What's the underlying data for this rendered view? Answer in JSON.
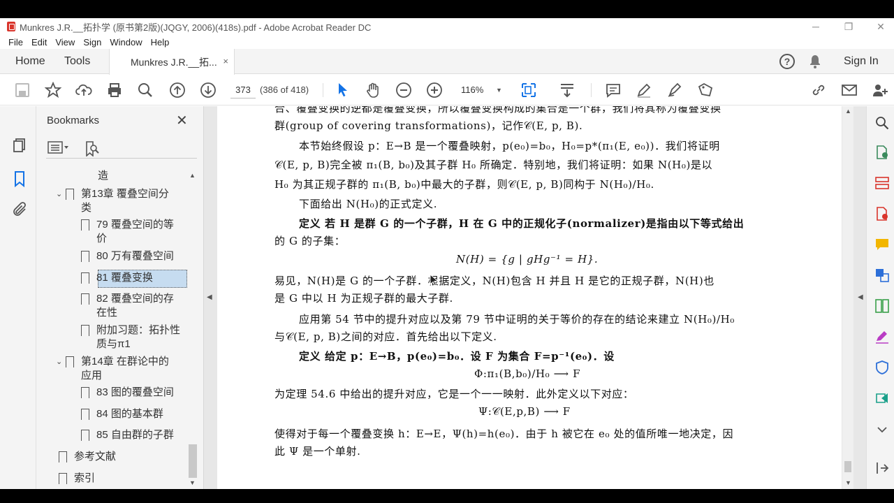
{
  "window": {
    "title": "Munkres J.R.__拓扑学 (原书第2版)(JQGY, 2006)(418s).pdf - Adobe Acrobat Reader DC",
    "minimize": "─",
    "restore": "❐",
    "close": "✕"
  },
  "menu": [
    "File",
    "Edit",
    "View",
    "Sign",
    "Window",
    "Help"
  ],
  "tabs": {
    "home": "Home",
    "tools": "Tools",
    "document": "Munkres J.R.__拓...",
    "close": "×",
    "signin": "Sign In",
    "help": "?"
  },
  "toolbar": {
    "page_number": "373",
    "page_count": "(386 of 418)",
    "zoom": "116%"
  },
  "bookmarks": {
    "title": "Bookmarks",
    "close": "✕",
    "items": [
      {
        "label": "造",
        "level": 2
      },
      {
        "label": "第13章  覆叠空间分类",
        "level": 1,
        "expanded": true
      },
      {
        "label": "79  覆叠空间的等价",
        "level": 2
      },
      {
        "label": "80  万有覆叠空间",
        "level": 2
      },
      {
        "label": "81  覆叠变换",
        "level": 2,
        "selected": true
      },
      {
        "label": "82  覆叠空间的存在性",
        "level": 2
      },
      {
        "label": "附加习题：拓扑性质与π1",
        "level": 2
      },
      {
        "label": "第14章  在群论中的应用",
        "level": 1,
        "expanded": true
      },
      {
        "label": "83  图的覆叠空间",
        "level": 2
      },
      {
        "label": "84  图的基本群",
        "level": 2
      },
      {
        "label": "85  自由群的子群",
        "level": 2
      },
      {
        "label": "参考文献",
        "level": 0
      },
      {
        "label": "索引",
        "level": 0
      }
    ]
  },
  "document": {
    "lines": [
      "合、覆叠变换的逆都是覆叠变换，所以覆叠变换构成的集合是一个群，我们将其称为覆叠变换",
      "群(group of covering transformations)，记作𝒞(E, p, B).",
      "本节始终假设 p：E→B 是一个覆叠映射，p(e₀)=b₀，H₀=p*(π₁(E, e₀))．我们将证明",
      "𝒞(E, p, B)完全被 π₁(B, b₀)及其子群 H₀ 所确定．特别地，我们将证明：如果 N(H₀)是以",
      "H₀ 为其正规子群的 π₁(B, b₀)中最大的子群，则𝒞(E, p, B)同构于 N(H₀)/H₀.",
      "下面给出 N(H₀)的正式定义.",
      "定义  若 H 是群 G 的一个子群，H 在 G 中的正规化子(normalizer)是指由以下等式给出",
      "的 G 的子集：",
      "N(H) = {g | gHg⁻¹ = H}.",
      "易见，N(H)是 G 的一个子群．根据定义，N(H)包含 H 并且 H 是它的正规子群，N(H)也",
      "是 G 中以 H 为正规子群的最大子群.",
      "应用第 54 节中的提升对应以及第 79 节中证明的关于等价的存在的结论来建立 N(H₀)/H₀",
      "与𝒞(E, p, B)之间的对应．首先给出以下定义.",
      "定义  给定 p：E→B，p(e₀)=b₀．设 F 为集合 F=p⁻¹(e₀)．设",
      "Φ:π₁(B,b₀)/H₀ ⟶ F",
      "为定理 54.6 中给出的提升对应，它是一个一一映射．此外定义以下对应：",
      "Ψ:𝒞(E,p,B) ⟶ F",
      "使得对于每一个覆叠变换 h：E→E，Ψ(h)=h(e₀)．由于 h 被它在 e₀ 处的值所唯一地决定，因",
      "此 Ψ 是一个单射."
    ]
  }
}
